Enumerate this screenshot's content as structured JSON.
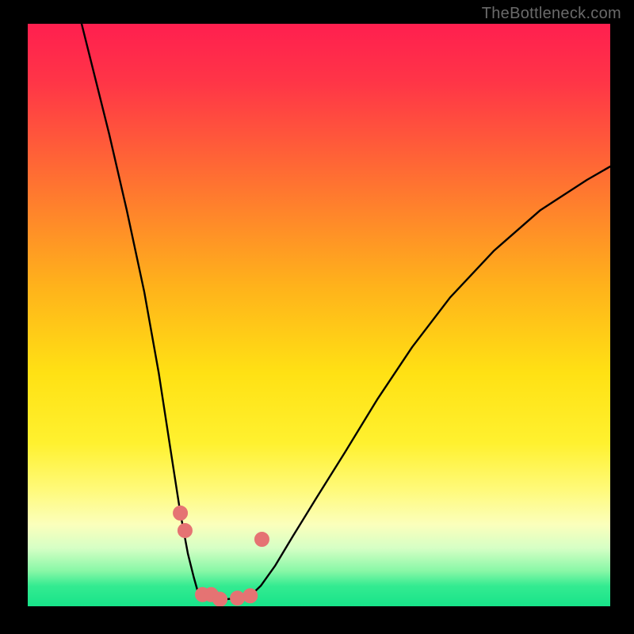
{
  "watermark": "TheBottleneck.com",
  "chart_data": {
    "type": "line",
    "title": "",
    "xlabel": "",
    "ylabel": "",
    "notes": "Bottleneck dip curve over a red→yellow→green vertical gradient. No numeric axes or tick labels are visible in the image; only the qualitative shape is shown.",
    "gradient_background": {
      "direction": "top-to-bottom",
      "stops": [
        {
          "offset": 0.0,
          "color": "#ff1f4f"
        },
        {
          "offset": 0.1,
          "color": "#ff3547"
        },
        {
          "offset": 0.25,
          "color": "#ff6a34"
        },
        {
          "offset": 0.45,
          "color": "#ffb21b"
        },
        {
          "offset": 0.6,
          "color": "#ffe114"
        },
        {
          "offset": 0.72,
          "color": "#fff12f"
        },
        {
          "offset": 0.8,
          "color": "#fffa7a"
        },
        {
          "offset": 0.86,
          "color": "#fbffbc"
        },
        {
          "offset": 0.9,
          "color": "#d6ffc5"
        },
        {
          "offset": 0.94,
          "color": "#87f7a6"
        },
        {
          "offset": 0.965,
          "color": "#34eb91"
        },
        {
          "offset": 1.0,
          "color": "#17e389"
        }
      ]
    },
    "series": [
      {
        "name": "left-branch",
        "stroke": "#000000",
        "stroke_width": 2.4,
        "x": [
          0.08,
          0.11,
          0.14,
          0.17,
          0.2,
          0.225,
          0.245,
          0.262,
          0.275,
          0.285,
          0.292,
          0.298
        ],
        "y": [
          1.05,
          0.93,
          0.81,
          0.68,
          0.54,
          0.4,
          0.27,
          0.16,
          0.09,
          0.05,
          0.025,
          0.014
        ]
      },
      {
        "name": "floor",
        "stroke": "#000000",
        "stroke_width": 2.4,
        "x": [
          0.298,
          0.34,
          0.38
        ],
        "y": [
          0.014,
          0.012,
          0.016
        ]
      },
      {
        "name": "right-branch",
        "stroke": "#000000",
        "stroke_width": 2.4,
        "x": [
          0.38,
          0.4,
          0.425,
          0.455,
          0.495,
          0.545,
          0.6,
          0.66,
          0.725,
          0.8,
          0.88,
          0.96,
          1.0
        ],
        "y": [
          0.016,
          0.035,
          0.07,
          0.12,
          0.185,
          0.265,
          0.355,
          0.445,
          0.53,
          0.61,
          0.68,
          0.732,
          0.755
        ]
      }
    ],
    "markers": {
      "shape": "circle",
      "radius_px": 9,
      "fill": "#e57373",
      "stroke": "#e57373",
      "points": [
        {
          "x": 0.262,
          "y": 0.16
        },
        {
          "x": 0.27,
          "y": 0.13
        },
        {
          "x": 0.3,
          "y": 0.02
        },
        {
          "x": 0.315,
          "y": 0.02
        },
        {
          "x": 0.33,
          "y": 0.012
        },
        {
          "x": 0.36,
          "y": 0.014
        },
        {
          "x": 0.382,
          "y": 0.018
        },
        {
          "x": 0.402,
          "y": 0.115
        }
      ]
    },
    "xlim": [
      0,
      1
    ],
    "ylim": [
      0,
      1
    ],
    "axes_visible": false
  }
}
